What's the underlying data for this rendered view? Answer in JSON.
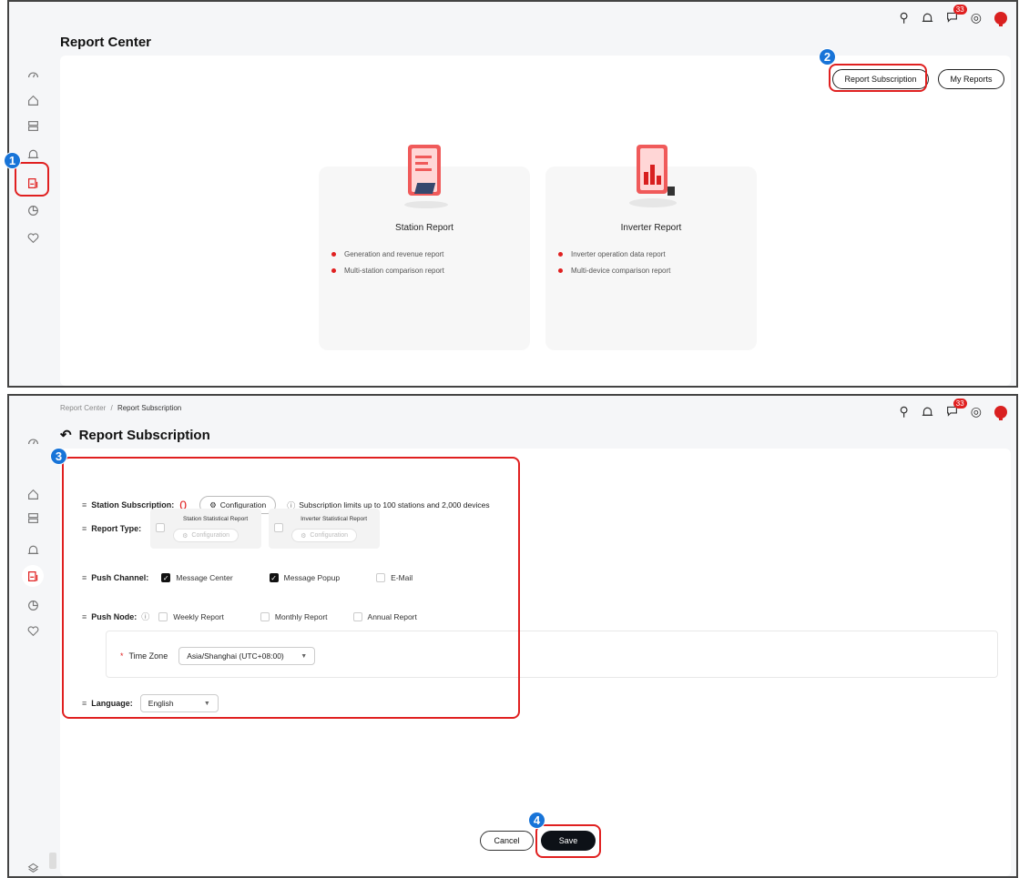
{
  "top": {
    "title": "Report Center",
    "buttons": {
      "subscription": "Report Subscription",
      "my_reports": "My Reports"
    },
    "notification_count": "33",
    "cards": [
      {
        "title": "Station Report",
        "items": [
          "Generation and revenue report",
          "Multi-station comparison report"
        ]
      },
      {
        "title": "Inverter Report",
        "items": [
          "Inverter operation data report",
          "Multi-device comparison report"
        ]
      }
    ]
  },
  "bottom": {
    "breadcrumb": {
      "parent": "Report Center",
      "separator": "/",
      "current": "Report Subscription"
    },
    "title": "Report Subscription",
    "notification_count": "33",
    "station_subscription": {
      "label": "Station Subscription:",
      "count": "0",
      "config": "Configuration",
      "hint": "Subscription limits up to 100 stations and 2,000 devices"
    },
    "report_type": {
      "label": "Report Type:",
      "station": "Station Statistical Report",
      "inverter": "Inverter Statistical Report",
      "config": "Configuration"
    },
    "push_channel": {
      "label": "Push Channel:",
      "options": [
        {
          "label": "Message Center",
          "checked": true
        },
        {
          "label": "Message Popup",
          "checked": true
        },
        {
          "label": "E-Mail",
          "checked": false
        }
      ]
    },
    "push_node": {
      "label": "Push Node:",
      "options": [
        "Weekly Report",
        "Monthly Report",
        "Annual Report"
      ]
    },
    "time_zone": {
      "label": "Time Zone",
      "value": "Asia/Shanghai (UTC+08:00)"
    },
    "language": {
      "label": "Language:",
      "value": "English"
    },
    "actions": {
      "cancel": "Cancel",
      "save": "Save"
    }
  },
  "annotations": [
    "1",
    "2",
    "3",
    "4"
  ],
  "colors": {
    "accent": "#e02020",
    "step_badge": "#1874d8",
    "primary_button": "#0d1117"
  }
}
